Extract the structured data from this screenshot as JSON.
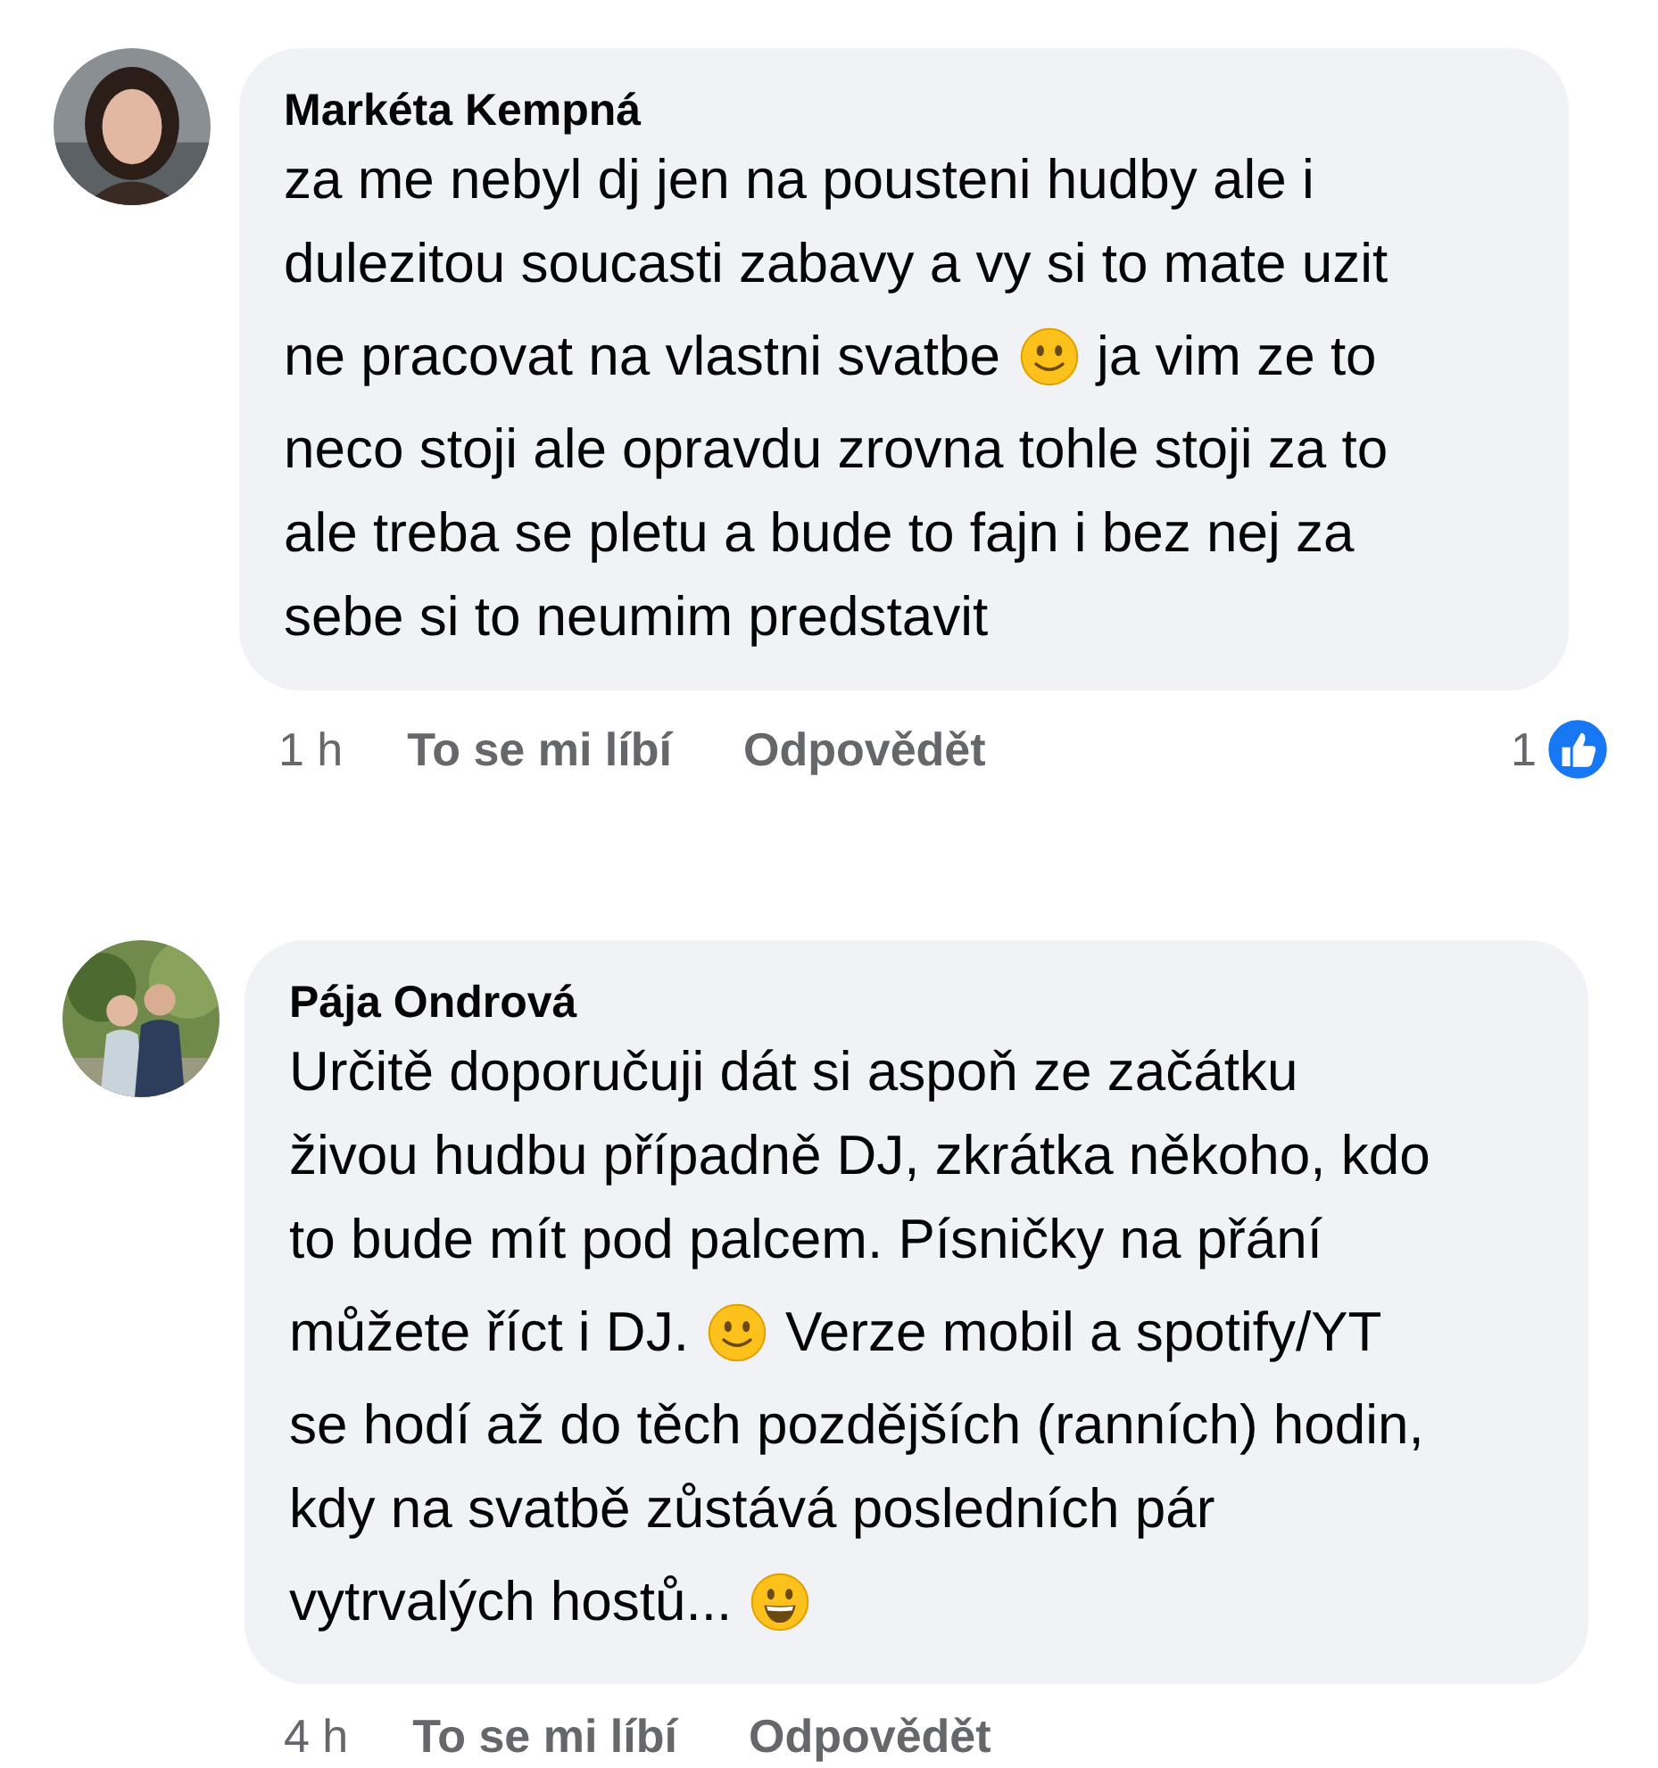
{
  "comments": [
    {
      "author": "Markéta Kempná",
      "lines": [
        [
          {
            "kind": "text",
            "text": "za me nebyl dj jen na pousteni hudby ale i"
          }
        ],
        [
          {
            "kind": "text",
            "text": "dulezitou soucasti zabavy a vy si to mate uzit"
          }
        ],
        [
          {
            "kind": "text",
            "text": "ne pracovat na vlastni svatbe"
          },
          {
            "kind": "smile"
          },
          {
            "kind": "text",
            "text": "ja vim ze to"
          }
        ],
        [
          {
            "kind": "text",
            "text": "neco stoji ale opravdu zrovna tohle stoji za to"
          }
        ],
        [
          {
            "kind": "text",
            "text": "ale treba se pletu a bude to fajn i bez nej za"
          }
        ],
        [
          {
            "kind": "text",
            "text": "sebe si to neumim predstavit"
          }
        ]
      ],
      "time": "1 h",
      "actions": [
        "To se mi líbí",
        "Odpovědět"
      ],
      "likes": "1"
    },
    {
      "author": "Pája Ondrová",
      "lines": [
        [
          {
            "kind": "text",
            "text": "Určitě doporučuji dát si aspoň ze začátku"
          }
        ],
        [
          {
            "kind": "text",
            "text": "živou hudbu případně DJ, zkrátka někoho, kdo"
          }
        ],
        [
          {
            "kind": "text",
            "text": "to bude mít pod palcem. Písničky na přání"
          }
        ],
        [
          {
            "kind": "text",
            "text": "můžete říct i DJ."
          },
          {
            "kind": "smile"
          },
          {
            "kind": "text",
            "text": "Verze mobil a spotify/YT"
          }
        ],
        [
          {
            "kind": "text",
            "text": "se hodí až do těch pozdějších (ranních) hodin,"
          }
        ],
        [
          {
            "kind": "text",
            "text": "kdy na svatbě zůstává posledních pár"
          }
        ],
        [
          {
            "kind": "text",
            "text": "vytrvalých hostů..."
          },
          {
            "kind": "grin"
          }
        ]
      ],
      "time": "4 h",
      "actions": [
        "To se mi líbí",
        "Odpovědět"
      ]
    }
  ]
}
